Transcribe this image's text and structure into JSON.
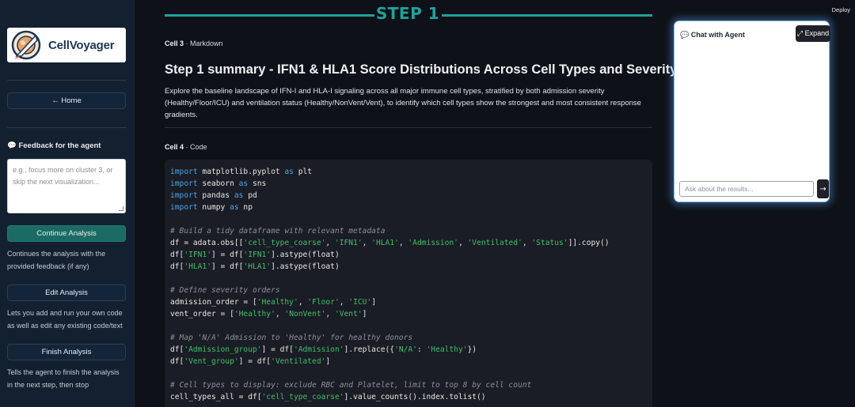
{
  "sidebar": {
    "logo_text": "CellVoyager",
    "home_label": "← Home",
    "feedback_label": "💬 Feedback for the agent",
    "feedback_placeholder": "e.g., focus more on cluster 3, or skip the next visualization...",
    "continue_label": "Continue Analysis",
    "continue_help": "Continues the analysis with the provided feedback (if any)",
    "edit_label": "Edit Analysis",
    "edit_help": "Lets you add and run your own code as well as edit any existing code/text",
    "finish_label": "Finish Analysis",
    "finish_help": "Tells the agent to finish the analysis in the next step, then stop"
  },
  "main": {
    "step_title": "STEP 1",
    "cell3": {
      "number": "Cell 3",
      "type": " · Markdown"
    },
    "md_heading": "Step 1 summary - IFN1 & HLA1 Score Distributions Across Cell Types and Severity",
    "md_body": "Explore the baseline landscape of IFN-I and HLA-I signaling across all major immune cell types, stratified by both admission severity (Healthy/Floor/ICU) and ventilation status (Healthy/NonVent/Vent), to identify which cell types show the strongest and most consistent response gradients.",
    "cell4": {
      "number": "Cell 4",
      "type": " · Code"
    },
    "code_lines": [
      [
        {
          "t": "import",
          "c": "kw"
        },
        {
          "t": " matplotlib.pyplot "
        },
        {
          "t": "as",
          "c": "kw"
        },
        {
          "t": " plt"
        }
      ],
      [
        {
          "t": "import",
          "c": "kw"
        },
        {
          "t": " seaborn "
        },
        {
          "t": "as",
          "c": "kw"
        },
        {
          "t": " sns"
        }
      ],
      [
        {
          "t": "import",
          "c": "kw"
        },
        {
          "t": " pandas "
        },
        {
          "t": "as",
          "c": "kw"
        },
        {
          "t": " pd"
        }
      ],
      [
        {
          "t": "import",
          "c": "kw"
        },
        {
          "t": " numpy "
        },
        {
          "t": "as",
          "c": "kw"
        },
        {
          "t": " np"
        }
      ],
      [],
      [
        {
          "t": "# Build a tidy dataframe with relevant metadata",
          "c": "cm"
        }
      ],
      [
        {
          "t": "df = adata.obs[["
        },
        {
          "t": "'cell_type_coarse'",
          "c": "str"
        },
        {
          "t": ", "
        },
        {
          "t": "'IFN1'",
          "c": "str"
        },
        {
          "t": ", "
        },
        {
          "t": "'HLA1'",
          "c": "str"
        },
        {
          "t": ", "
        },
        {
          "t": "'Admission'",
          "c": "str"
        },
        {
          "t": ", "
        },
        {
          "t": "'Ventilated'",
          "c": "str"
        },
        {
          "t": ", "
        },
        {
          "t": "'Status'",
          "c": "str"
        },
        {
          "t": "]].copy()"
        }
      ],
      [
        {
          "t": "df["
        },
        {
          "t": "'IFN1'",
          "c": "str"
        },
        {
          "t": "] = df["
        },
        {
          "t": "'IFN1'",
          "c": "str"
        },
        {
          "t": "].astype(float)"
        }
      ],
      [
        {
          "t": "df["
        },
        {
          "t": "'HLA1'",
          "c": "str"
        },
        {
          "t": "] = df["
        },
        {
          "t": "'HLA1'",
          "c": "str"
        },
        {
          "t": "].astype(float)"
        }
      ],
      [],
      [
        {
          "t": "# Define severity orders",
          "c": "cm"
        }
      ],
      [
        {
          "t": "admission_order = ["
        },
        {
          "t": "'Healthy'",
          "c": "str"
        },
        {
          "t": ", "
        },
        {
          "t": "'Floor'",
          "c": "str"
        },
        {
          "t": ", "
        },
        {
          "t": "'ICU'",
          "c": "str"
        },
        {
          "t": "]"
        }
      ],
      [
        {
          "t": "vent_order = ["
        },
        {
          "t": "'Healthy'",
          "c": "str"
        },
        {
          "t": ", "
        },
        {
          "t": "'NonVent'",
          "c": "str"
        },
        {
          "t": ", "
        },
        {
          "t": "'Vent'",
          "c": "str"
        },
        {
          "t": "]"
        }
      ],
      [],
      [
        {
          "t": "# Map 'N/A' Admission to 'Healthy' for healthy donors",
          "c": "cm"
        }
      ],
      [
        {
          "t": "df["
        },
        {
          "t": "'Admission_group'",
          "c": "str"
        },
        {
          "t": "] = df["
        },
        {
          "t": "'Admission'",
          "c": "str"
        },
        {
          "t": "].replace({"
        },
        {
          "t": "'N/A'",
          "c": "str"
        },
        {
          "t": ": "
        },
        {
          "t": "'Healthy'",
          "c": "str"
        },
        {
          "t": "})"
        }
      ],
      [
        {
          "t": "df["
        },
        {
          "t": "'Vent_group'",
          "c": "str"
        },
        {
          "t": "] = df["
        },
        {
          "t": "'Ventilated'",
          "c": "str"
        },
        {
          "t": "]"
        }
      ],
      [],
      [
        {
          "t": "# Cell types to display: exclude RBC and Platelet, limit to top 8 by cell count",
          "c": "cm"
        }
      ],
      [
        {
          "t": "cell_types_all = df["
        },
        {
          "t": "'cell_type_coarse'",
          "c": "str"
        },
        {
          "t": "].value_counts().index.tolist()"
        }
      ]
    ]
  },
  "chat": {
    "deploy_label": "Deploy",
    "title": "💬 Chat with Agent",
    "expand_label": "⤢ Expand",
    "input_placeholder": "Ask about the results...",
    "send_icon": "→"
  }
}
